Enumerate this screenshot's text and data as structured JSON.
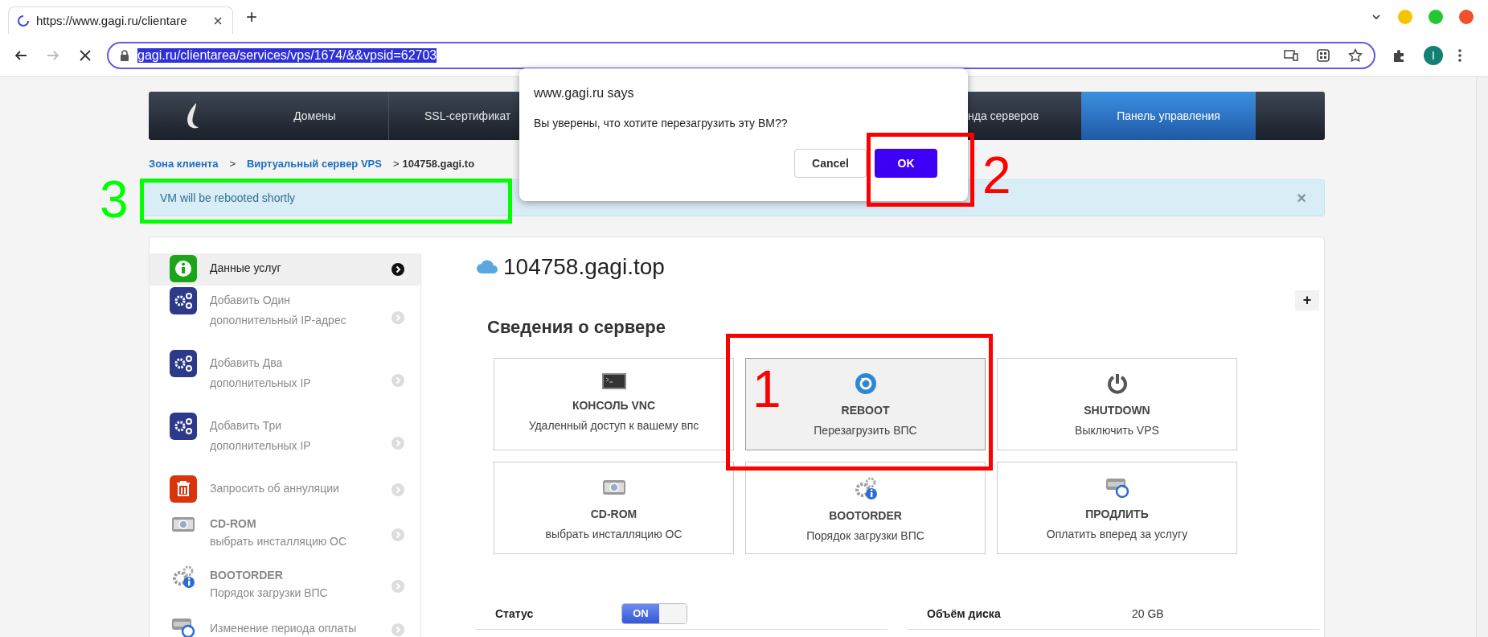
{
  "browser": {
    "tab": {
      "title": "https://www.gagi.ru/clientare",
      "loading": true
    },
    "new_tab": "+",
    "address": {
      "value": "gagi.ru/clientarea/services/vps/1674/&&vpsid=62703",
      "selected": true
    },
    "avatar": "I"
  },
  "nav": {
    "items": [
      {
        "label": "Домены",
        "selected": false
      },
      {
        "label": "SSL-сертификат",
        "selected": false
      },
      {
        "label": "нда серверов",
        "selected": false
      },
      {
        "label": "Панель управления",
        "selected": true
      }
    ]
  },
  "breadcrumb": [
    {
      "label": "Зона клиента",
      "kind": "link"
    },
    {
      "label": ">",
      "kind": "separator"
    },
    {
      "label": "Виртуальный сервер VPS",
      "kind": "link"
    },
    {
      "label": ">",
      "kind": "separator"
    },
    {
      "label": "104758.gagi.to",
      "kind": "current"
    }
  ],
  "alert": {
    "text": "VM will be rebooted shortly",
    "close": "×"
  },
  "sidebar": {
    "items": [
      {
        "kind": "single",
        "text": "Данные услуг",
        "selected": true
      },
      {
        "kind": "wrap",
        "text": "Добавить Один дополнительный IP-адрес",
        "selected": false
      },
      {
        "kind": "wrap",
        "text": "Добавить Два дополнительных IP",
        "selected": false
      },
      {
        "kind": "wrap",
        "text": "Добавить Три дополнительных IP",
        "selected": false
      },
      {
        "kind": "single",
        "text": "Запросить об аннуляции",
        "selected": false
      },
      {
        "kind": "titled",
        "title": "CD-ROM",
        "text": "выбрать инсталляцию ОС",
        "selected": false
      },
      {
        "kind": "titled",
        "title": "BOOTORDER",
        "text": "Порядок загрузки ВПС",
        "selected": false
      },
      {
        "kind": "single",
        "text": "Изменение периода оплаты",
        "selected": false
      }
    ]
  },
  "main": {
    "title": "104758.gagi.top",
    "expand": "+",
    "section": "Сведения о сервере",
    "actions": [
      {
        "title": "КОНСОЛЬ VNC",
        "text": "Удаленный доступ к вашему впс",
        "selected": false
      },
      {
        "title": "REBOOT",
        "text": "Перезагрузить ВПС",
        "selected": true
      },
      {
        "title": "SHUTDOWN",
        "text": "Выключить VPS",
        "selected": false
      },
      {
        "title": "CD-ROM",
        "text": "выбрать инсталляцию ОС",
        "selected": false
      },
      {
        "title": "BOOTORDER",
        "text": "Порядок загрузки ВПС",
        "selected": false
      },
      {
        "title": "ПРОДЛИТЬ",
        "text": "Оплатить вперед за услугу",
        "selected": false
      }
    ],
    "details": [
      {
        "kind": "toggle",
        "label": "Статус",
        "value": "ON",
        "on": true
      },
      {
        "kind": "text",
        "label": "Объём диска",
        "value": "20 GB"
      }
    ]
  },
  "dialog": {
    "origin": "www.gagi.ru says",
    "message": "Вы уверены, что хотите перезагрузить эту ВМ??",
    "buttons": [
      {
        "label": "Cancel",
        "primary": false
      },
      {
        "label": "OK",
        "primary": true
      }
    ]
  },
  "annotations": [
    {
      "label": "1",
      "color": "#ff0000"
    },
    {
      "label": "2",
      "color": "#ff0000"
    },
    {
      "label": "3",
      "color": "#00ff00"
    }
  ]
}
